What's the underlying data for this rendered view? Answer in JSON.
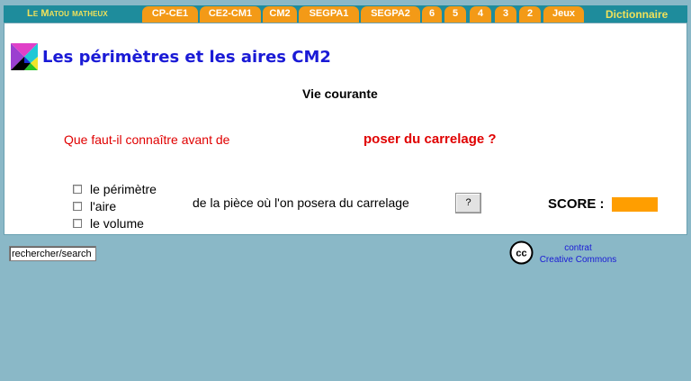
{
  "nav": {
    "brand": "Le Matou matheux",
    "tabs": [
      {
        "label": "CP-CE1"
      },
      {
        "label": "CE2-CM1"
      },
      {
        "label": "CM2"
      },
      {
        "label": "SEGPA1"
      },
      {
        "label": "SEGPA2"
      },
      {
        "label": "6"
      },
      {
        "label": "5"
      },
      {
        "label": "4"
      },
      {
        "label": "3"
      },
      {
        "label": "2"
      },
      {
        "label": "Jeux"
      }
    ],
    "dictionary": "Dictionnaire",
    "colors": {
      "bar": "#1e8c9c",
      "tab": "#f39a17",
      "brand": "#f0e15a"
    }
  },
  "page": {
    "title": "Les périmètres et les aires CM2",
    "subtitle": "Vie courante"
  },
  "exercise": {
    "question_prefix": "Que faut-il connaître avant de",
    "question_emphasis": "poser du carrelage ?",
    "options": [
      {
        "label": "le périmètre",
        "checked": false
      },
      {
        "label": "l'aire",
        "checked": false
      },
      {
        "label": "le volume",
        "checked": false
      }
    ],
    "sentence": "de la pièce où l'on posera du carrelage",
    "help_button": "?",
    "score_label": "SCORE :",
    "score_value": ""
  },
  "footer": {
    "search_value": "rechercher/search",
    "license_line1": "contrat",
    "license_line2": "Creative Commons",
    "license_icon": "cc"
  }
}
